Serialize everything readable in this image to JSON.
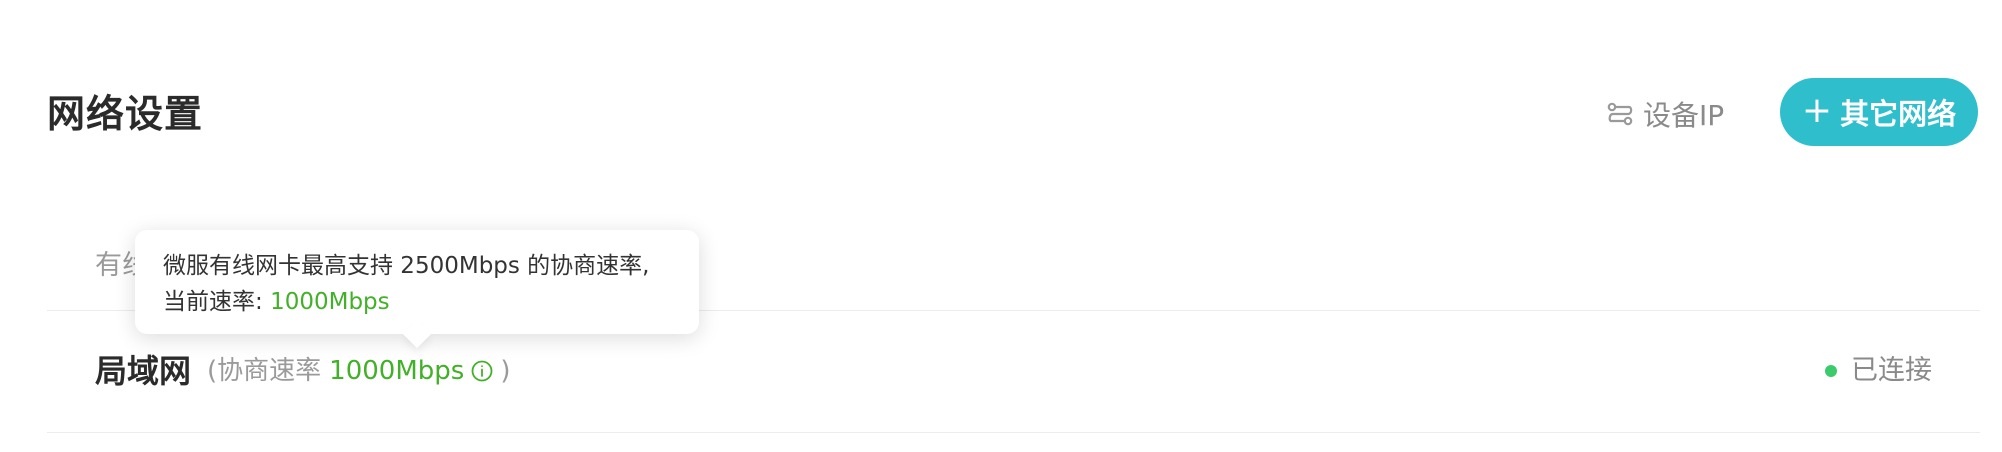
{
  "header": {
    "title": "网络设置",
    "device_ip_label": "设备IP",
    "other_network_label": "其它网络",
    "accent_color": "#2fbecb"
  },
  "section": {
    "label": "有线网络"
  },
  "lan": {
    "name": "局域网",
    "speed_prefix": "(协商速率",
    "speed_value": "1000Mbps",
    "speed_suffix": ")",
    "status": "已连接",
    "status_color": "#3ccb6b"
  },
  "tooltip": {
    "line1": "微服有线网卡最高支持 2500Mbps 的协商速率,",
    "line2_prefix": "当前速率:",
    "line2_speed": "1000Mbps"
  }
}
